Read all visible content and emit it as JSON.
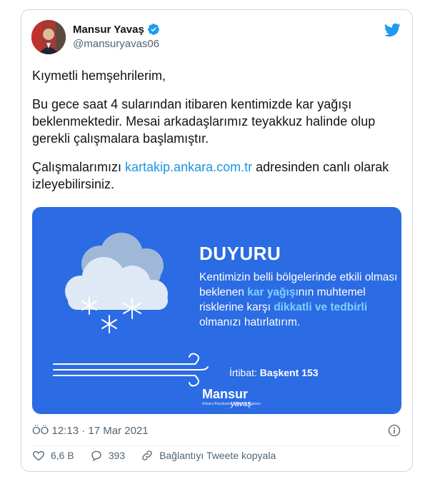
{
  "author": {
    "display_name": "Mansur Yavaş",
    "handle": "@mansuryavas06"
  },
  "tweet": {
    "paragraph1": "Kıymetli hemşehrilerim,",
    "paragraph2": "Bu gece saat 4 sularından itibaren kentimizde kar yağışı beklenmektedir. Mesai arkadaşlarımız teyakkuz halinde olup gerekli çalışmalara başlamıştır.",
    "paragraph3_pre": "Çalışmalarımızı ",
    "paragraph3_link": "kartakip.ankara.com.tr",
    "paragraph3_post": " adresinden canlı olarak izleyebilirsiniz."
  },
  "media": {
    "title": "DUYURU",
    "body_1": "Kentimizin belli bölgelerinde etkili olması beklenen ",
    "body_highlight_1": "kar yağışı",
    "body_2": "nın muhtemel risklerine karşı ",
    "body_highlight_2": "dikkatli ve tedbirli",
    "body_3": " olmanızı hatırlatırım.",
    "contact_label": "İrtibat: ",
    "contact_value": "Başkent 153",
    "logo_name": "Mansur",
    "logo_sub": "Ankara Büyükşehir Belediye Başkanı",
    "logo_script": "yavaş",
    "background_color": "#2b6be3"
  },
  "meta": {
    "timestamp": "ÖÖ 12:13 · 17 Mar 2021"
  },
  "actions": {
    "likes": "6,6 B",
    "replies": "393",
    "copy_link": "Bağlantıyı Tweete kopyala"
  },
  "icons": {
    "verified": "verified-badge-icon",
    "bird": "twitter-bird-icon",
    "info": "info-icon",
    "like": "heart-icon",
    "reply": "reply-bubble-icon",
    "link": "link-icon"
  },
  "colors": {
    "twitter_blue": "#1d9bf0",
    "link": "#1b95e0",
    "muted": "#536471"
  }
}
